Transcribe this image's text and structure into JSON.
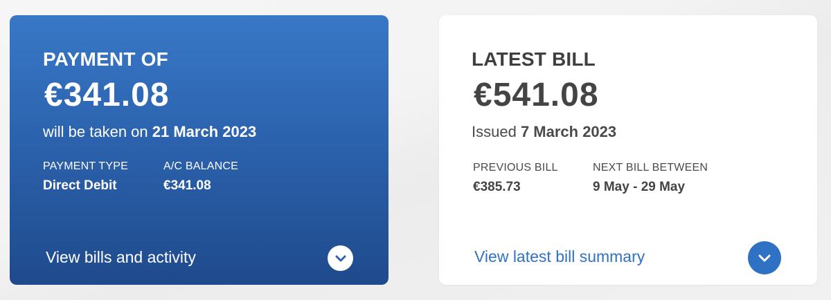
{
  "payment_card": {
    "eyebrow": "PAYMENT OF",
    "amount": "€341.08",
    "subline_prefix": "will be taken on ",
    "subline_date": "21 March 2023",
    "payment_type_label": "PAYMENT TYPE",
    "payment_type_value": "Direct Debit",
    "balance_label": "A/C BALANCE",
    "balance_value": "€341.08",
    "link_label": "View bills and activity",
    "chevron_icon": "chevron-down-icon",
    "colors": {
      "gradient_top": "#3878c7",
      "gradient_bottom": "#1f4a8c",
      "text": "#ffffff"
    }
  },
  "bill_card": {
    "eyebrow": "LATEST BILL",
    "amount": "€541.08",
    "subline_prefix": "Issued ",
    "subline_date": "7 March 2023",
    "previous_label": "PREVIOUS BILL",
    "previous_value": "€385.73",
    "next_label": "NEXT BILL BETWEEN",
    "next_value": "9 May - 29 May",
    "link_label": "View latest bill summary",
    "chevron_icon": "chevron-down-icon",
    "colors": {
      "background": "#ffffff",
      "text": "#4a4a4a",
      "link": "#2f72c4",
      "button": "#2f72c4"
    }
  }
}
